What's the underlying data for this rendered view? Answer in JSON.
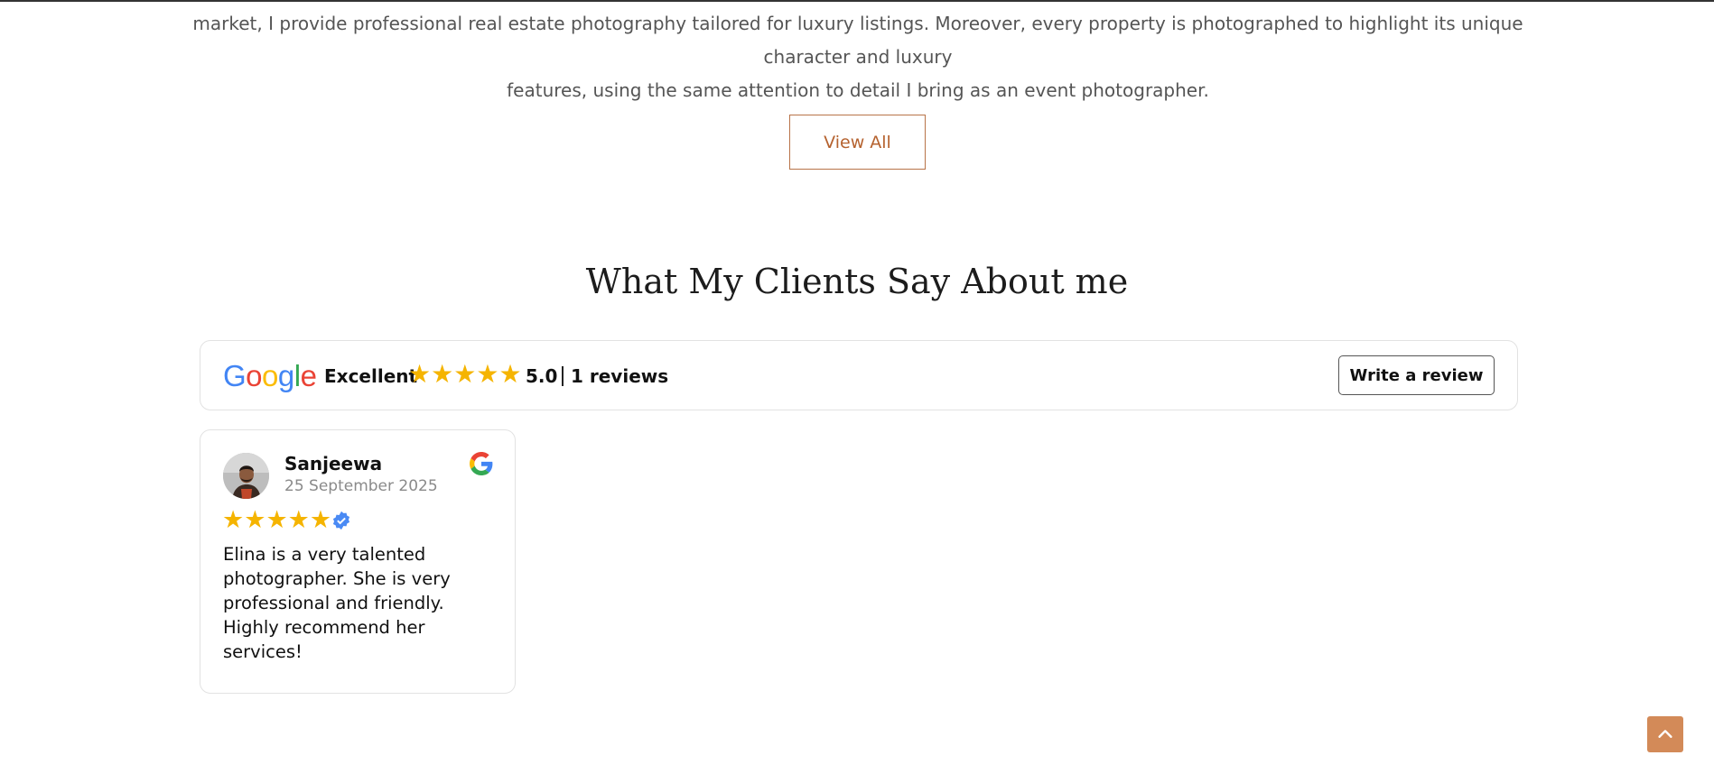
{
  "intro": {
    "line1": "market, I provide professional real estate photography tailored for luxury listings. Moreover, every property is photographed to highlight its unique character and luxury",
    "line2": "features, using the same attention to detail I bring as an event photographer."
  },
  "view_all_label": "View All",
  "testimonials": {
    "title": "What My Clients Say About me",
    "summary": {
      "logo_letters": [
        "G",
        "o",
        "o",
        "g",
        "l",
        "e"
      ],
      "logo_colors": [
        "#4285F4",
        "#EA4335",
        "#FBBC05",
        "#4285F4",
        "#34A853",
        "#EA4335"
      ],
      "rating_label": "Excellent",
      "stars": 5,
      "score": "5.0",
      "count": "1 reviews",
      "write_review_label": "Write a review",
      "star_color": "#f5b400"
    },
    "reviews": [
      {
        "name": "Sanjeewa",
        "date": "25 September 2025",
        "stars": 5,
        "verified": true,
        "text": "Elina is a very talented photographer. She is very professional and friendly. Highly recommend her services!",
        "source_icon": "google-g-icon"
      }
    ]
  },
  "back_to_top": {
    "icon": "chevron-up-icon",
    "color": "#d38a58"
  }
}
